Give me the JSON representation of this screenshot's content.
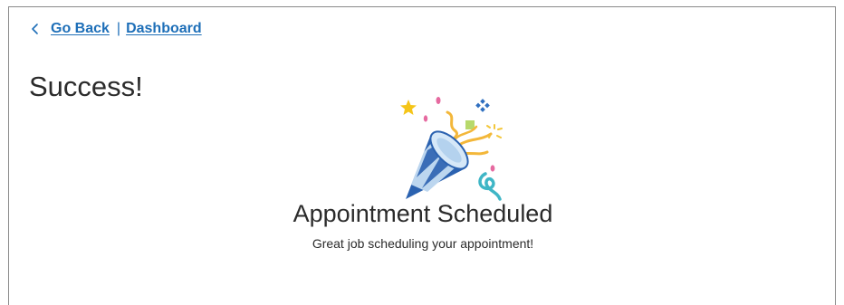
{
  "nav": {
    "back_icon": "chevron-left-icon",
    "back_label": "Go Back",
    "separator": "|",
    "dashboard_label": "Dashboard",
    "link_color": "#1e6fb8"
  },
  "page": {
    "title": "Success!"
  },
  "illustration": {
    "icon": "party-popper-icon"
  },
  "message": {
    "headline": "Appointment Scheduled",
    "subtext": "Great job scheduling your appointment!"
  }
}
